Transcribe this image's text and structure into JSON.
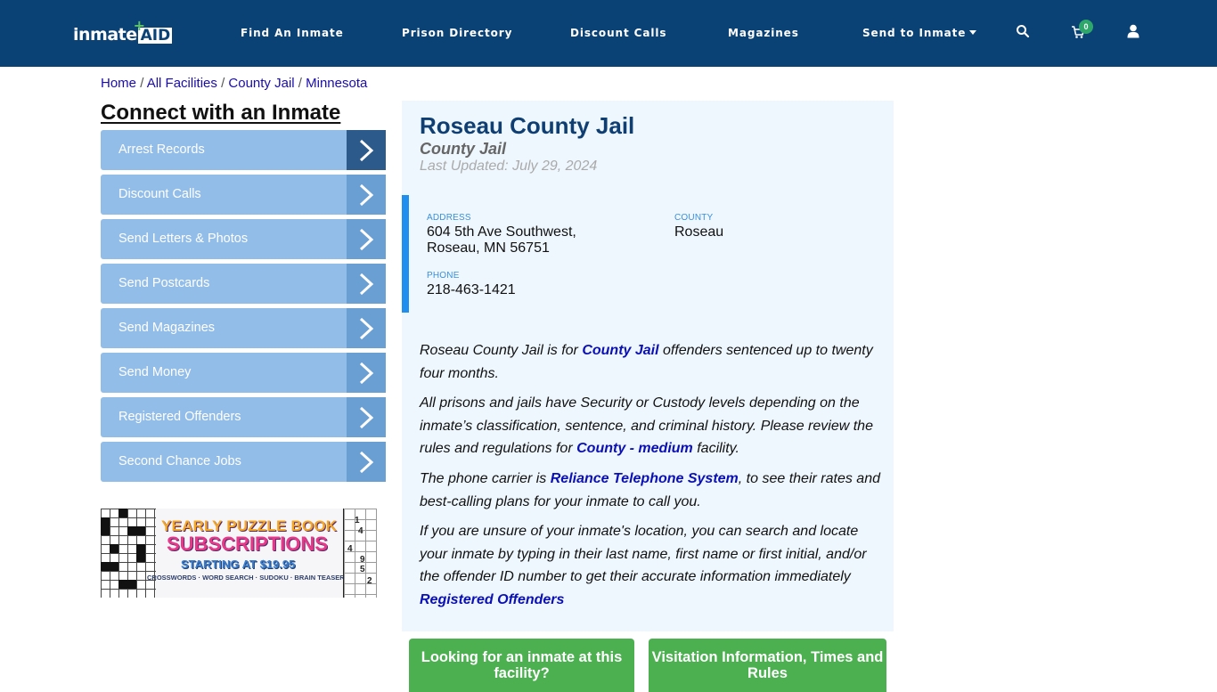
{
  "header": {
    "logo": {
      "text": "inmate",
      "accent": "AID",
      "plus": "+"
    },
    "nav": [
      {
        "label": "Find An Inmate"
      },
      {
        "label": "Prison Directory"
      },
      {
        "label": "Discount Calls"
      },
      {
        "label": "Magazines"
      },
      {
        "label": "Send to Inmate",
        "has_dropdown": true
      }
    ],
    "icons": {
      "search": "search-icon",
      "cart": "cart-icon",
      "user": "user-icon"
    },
    "cart_count": "0",
    "colors": {
      "background": "#0b4275",
      "badge": "#2ea86a"
    }
  },
  "breadcrumb": {
    "items": [
      "Home",
      "All Facilities",
      "County Jail",
      "Minnesota"
    ],
    "separator": "/"
  },
  "sidebar": {
    "title": "Connect with an Inmate",
    "items": [
      {
        "label": "Arrest Records",
        "active": true
      },
      {
        "label": "Discount Calls"
      },
      {
        "label": "Send Letters & Photos"
      },
      {
        "label": "Send Postcards"
      },
      {
        "label": "Send Magazines"
      },
      {
        "label": "Send Money"
      },
      {
        "label": "Registered Offenders"
      },
      {
        "label": "Second Chance Jobs"
      }
    ],
    "banner": {
      "line1": "YEARLY PUZZLE BOOK",
      "line2": "SUBSCRIPTIONS",
      "line3": "STARTING AT $19.95",
      "line4": "CROSSWORDS · WORD SEARCH · SUDOKU · BRAIN TEASERS",
      "sudoku_digits": [
        "1",
        "4",
        "4",
        "9",
        "5",
        "2"
      ]
    }
  },
  "facility": {
    "name": "Roseau County Jail",
    "type": "County Jail",
    "last_updated": "Last Updated: July 29, 2024",
    "address_label": "ADDRESS",
    "address_line1": "604 5th Ave Southwest,",
    "address_line2": "Roseau, MN 56751",
    "county_label": "COUNTY",
    "county": "Roseau",
    "phone_label": "PHONE",
    "phone": "218-463-1421"
  },
  "description": {
    "p1": {
      "before": "Roseau County Jail is for ",
      "link": "County Jail",
      "after": " offenders sentenced up to twenty four months."
    },
    "p2": {
      "before": "All prisons and jails have Security or Custody levels depending on the inmate’s classification, sentence, and criminal history. Please review the rules and regulations for ",
      "link": "County - medium",
      "after": " facility."
    },
    "p3": {
      "before": "The phone carrier is ",
      "link": "Reliance Telephone System",
      "after": ", to see their rates and best-calling plans for your inmate to call you."
    },
    "p4": {
      "before": "If you are unsure of your inmate's location, you can search and locate your inmate by typing in their last name, first name or first initial, and/or the offender ID number to get their accurate information immediately",
      "link": "Registered Offenders"
    }
  },
  "actions": {
    "find_inmate": "Looking for an inmate at this facility?",
    "visitation": "Visitation Information, Times and Rules"
  }
}
